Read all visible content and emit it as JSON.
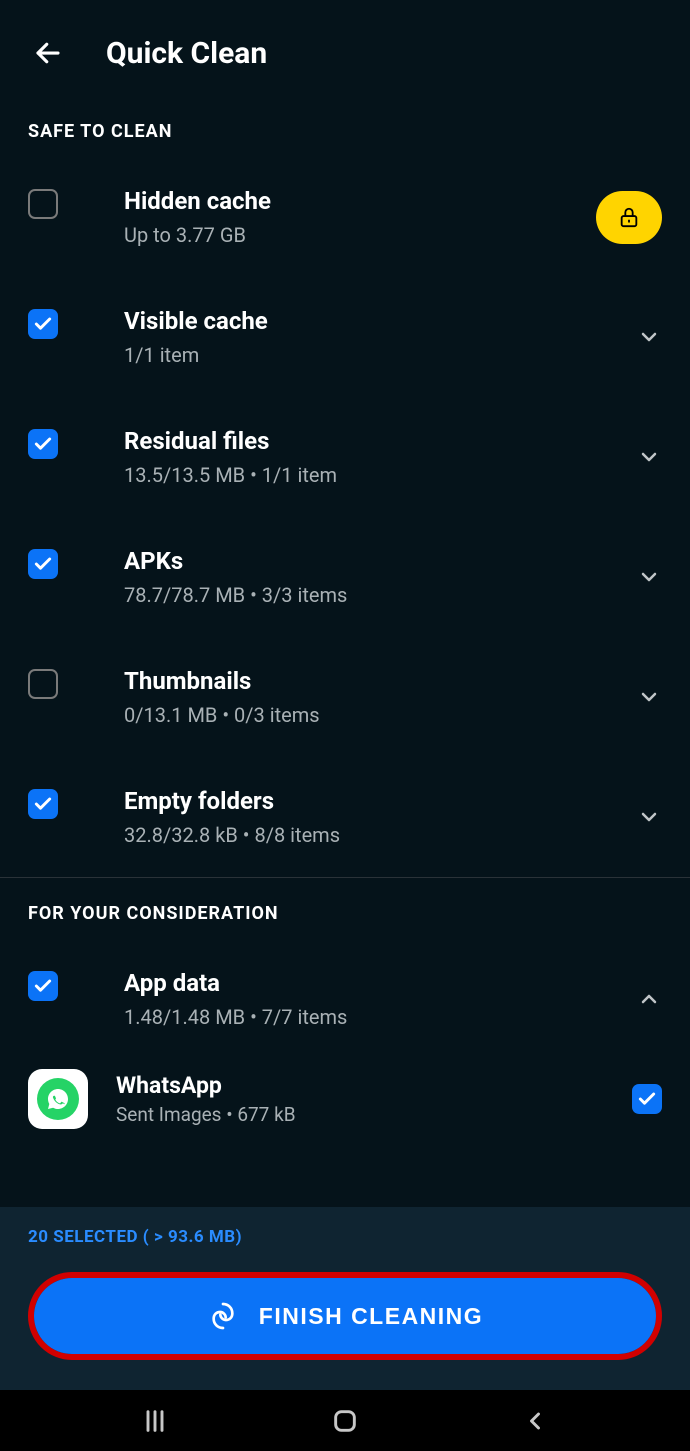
{
  "header": {
    "title": "Quick Clean"
  },
  "sections": {
    "safe": {
      "label": "SAFE TO CLEAN",
      "items": [
        {
          "title": "Hidden cache",
          "subtitle": "Up to 3.77 GB",
          "checked": false,
          "locked": true
        },
        {
          "title": "Visible cache",
          "subtitle": "1/1 item",
          "checked": true
        },
        {
          "title": "Residual files",
          "subtitle": "13.5/13.5 MB  •  1/1 item",
          "checked": true
        },
        {
          "title": "APKs",
          "subtitle": "78.7/78.7 MB  •  3/3 items",
          "checked": true
        },
        {
          "title": "Thumbnails",
          "subtitle": "0/13.1 MB  •  0/3 items",
          "checked": false
        },
        {
          "title": "Empty folders",
          "subtitle": "32.8/32.8 kB  •  8/8 items",
          "checked": true
        }
      ]
    },
    "consideration": {
      "label": "FOR YOUR CONSIDERATION",
      "items": [
        {
          "title": "App data",
          "subtitle": "1.48/1.48 MB  •  7/7 items",
          "checked": true,
          "expanded": true
        }
      ]
    }
  },
  "nested": {
    "appicon": "whatsapp",
    "title": "WhatsApp",
    "subtitle": "Sent Images  •  677 kB",
    "checked": true
  },
  "bottomBar": {
    "selected": "20 SELECTED ( > 93.6 MB)",
    "cta": "FINISH CLEANING"
  }
}
